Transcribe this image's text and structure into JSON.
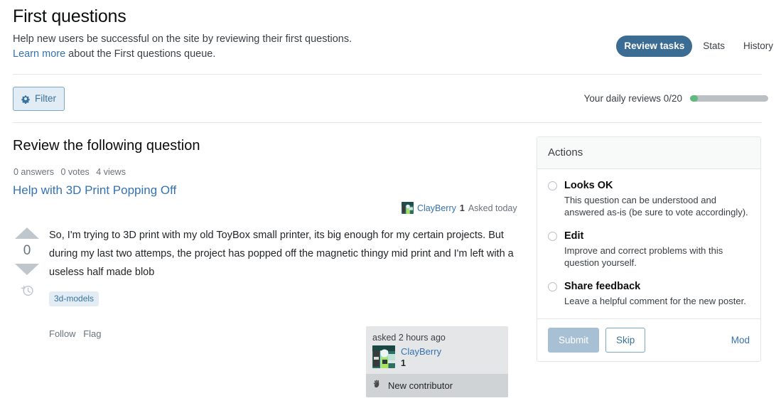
{
  "header": {
    "title": "First questions",
    "subtitle": "Help new users be successful on the site by reviewing their first questions.",
    "learn_more_link": "Learn more",
    "learn_more_rest": " about the First questions queue.",
    "nav": [
      {
        "label": "Review tasks",
        "active": true
      },
      {
        "label": "Stats",
        "active": false
      },
      {
        "label": "History",
        "active": false
      }
    ]
  },
  "toolbar": {
    "filter_label": "Filter",
    "filter_icon": "gear-icon",
    "daily_reviews_label": "Your daily reviews 0/20",
    "daily_reviews_current": 0,
    "daily_reviews_total": 20,
    "progress_fill_color": "#5eba7d",
    "progress_track_color": "#bbc0c4"
  },
  "main": {
    "review_heading": "Review the following question",
    "stats": {
      "answers": "0 answers",
      "votes": "0 votes",
      "views": "4 views"
    },
    "question_title": "Help with 3D Print Popping Off",
    "byline": {
      "avatar": "user-avatar",
      "username": "ClayBerry",
      "reputation": "1",
      "asked": "Asked today"
    },
    "vote": {
      "up_icon": "upvote-arrow-icon",
      "count": "0",
      "down_icon": "downvote-arrow-icon",
      "history_icon": "post-history-icon"
    },
    "body": "So, I'm trying to 3D print with my old ToyBox small printer, its big enough for my certain projects. But during my last two attemps, the project has popped off the magnetic thingy mid print and I'm left with a useless half made blob",
    "tags": [
      "3d-models"
    ],
    "post_actions": [
      "Follow",
      "Flag"
    ]
  },
  "usercard": {
    "asked_text": "asked 2 hours ago",
    "avatar": "user-avatar",
    "username": "ClayBerry",
    "reputation": "1",
    "badge_icon": "waving-hand-icon",
    "badge_label": "New contributor"
  },
  "actions": {
    "panel_title": "Actions",
    "options": [
      {
        "title": "Looks OK",
        "desc": "This question can be understood and answered as-is (be sure to vote accordingly).",
        "selected": false
      },
      {
        "title": "Edit",
        "desc": "Improve and correct problems with this question yourself.",
        "selected": false
      },
      {
        "title": "Share feedback",
        "desc": "Leave a helpful comment for the new poster.",
        "selected": false
      }
    ],
    "submit_label": "Submit",
    "skip_label": "Skip",
    "mod_label": "Mod"
  },
  "colors": {
    "accent": "#3572b0",
    "pill_active_bg": "#3b6c93",
    "tag_bg": "#e1ecf4",
    "tag_fg": "#39739d",
    "submit_disabled_bg": "#a8c0d3"
  }
}
